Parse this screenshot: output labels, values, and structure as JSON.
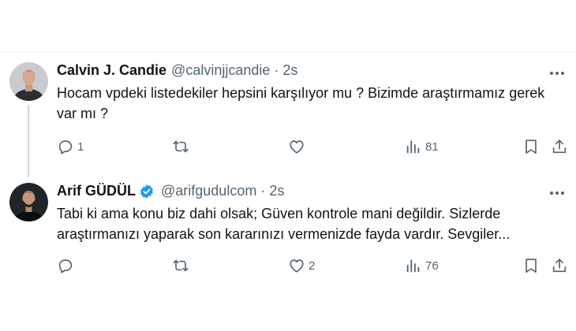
{
  "tweets": [
    {
      "name": "Calvin J. Candie",
      "handle": "@calvinjjcandie",
      "separator": "·",
      "time": "2s",
      "verified": false,
      "text": "Hocam vpdeki listedekiler hepsini karşılıyor mu ? Bizimde araştırmamız gerek var mı ?",
      "replies": "1",
      "retweets": "",
      "likes": "",
      "views": "81"
    },
    {
      "name": "Arif GÜDÜL",
      "handle": "@arifgudulcom",
      "separator": "·",
      "time": "2s",
      "verified": true,
      "text": "Tabi ki ama konu biz dahi olsak; Güven kontrole mani değildir. Sizlerde araştırmanızı yaparak son kararınızı vermenizde fayda vardır. Sevgiler...",
      "replies": "",
      "retweets": "",
      "likes": "2",
      "views": "76"
    }
  ],
  "colors": {
    "text": "#0f1419",
    "secondary": "#536471",
    "verified": "#1d9bf0",
    "thread_line": "#cfd9de"
  },
  "icons": [
    "reply-icon",
    "retweet-icon",
    "like-icon",
    "views-icon",
    "bookmark-icon",
    "share-icon",
    "more-icon",
    "verified-badge-icon"
  ]
}
